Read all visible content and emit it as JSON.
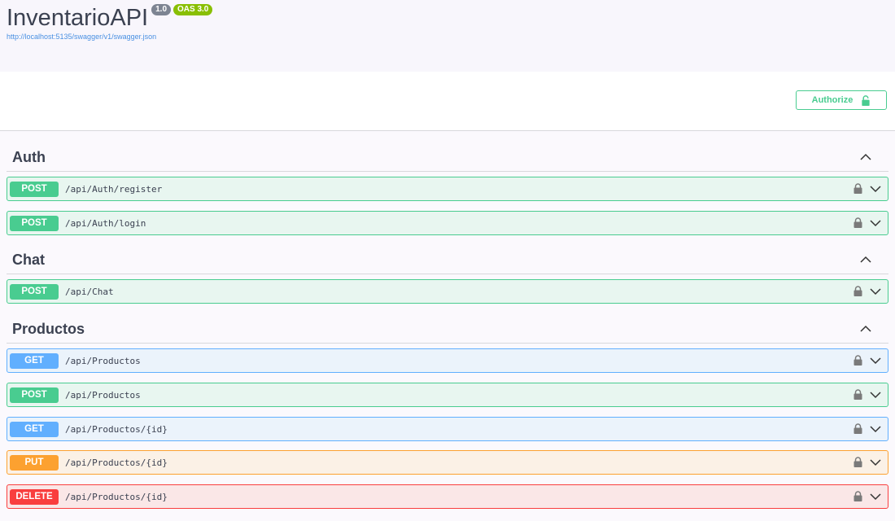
{
  "info": {
    "title": "InventarioAPI",
    "version_badge": "1.0",
    "oas_badge": "OAS 3.0",
    "spec_url": "http://localhost:5135/swagger/v1/swagger.json"
  },
  "scheme": {
    "authorize_label": "Authorize"
  },
  "tags": [
    {
      "name": "Auth",
      "operations": [
        {
          "method": "POST",
          "path": "/api/Auth/register"
        },
        {
          "method": "POST",
          "path": "/api/Auth/login"
        }
      ]
    },
    {
      "name": "Chat",
      "operations": [
        {
          "method": "POST",
          "path": "/api/Chat"
        }
      ]
    },
    {
      "name": "Productos",
      "operations": [
        {
          "method": "GET",
          "path": "/api/Productos"
        },
        {
          "method": "POST",
          "path": "/api/Productos"
        },
        {
          "method": "GET",
          "path": "/api/Productos/{id}"
        },
        {
          "method": "PUT",
          "path": "/api/Productos/{id}"
        },
        {
          "method": "DELETE",
          "path": "/api/Productos/{id}"
        }
      ]
    }
  ],
  "colors": {
    "post": "#49cc90",
    "get": "#61affe",
    "put": "#fca130",
    "delete": "#f93e3e"
  }
}
